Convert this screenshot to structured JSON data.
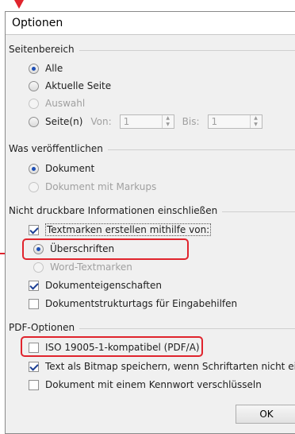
{
  "dialog": {
    "title": "Optionen"
  },
  "page_range": {
    "heading": "Seitenbereich",
    "all": "Alle",
    "current": "Aktuelle Seite",
    "selection": "Auswahl",
    "pages": "Seite(n)",
    "from_label": "Von:",
    "from_value": "1",
    "to_label": "Bis:",
    "to_value": "1"
  },
  "publish": {
    "heading": "Was veröffentlichen",
    "document": "Dokument",
    "document_markups": "Dokument mit Markups"
  },
  "nonprint": {
    "heading": "Nicht druckbare Informationen einschließen",
    "bookmarks": "Textmarken erstellen mithilfe von:",
    "headings": "Überschriften",
    "word_bookmarks": "Word-Textmarken",
    "doc_properties": "Dokumenteigenschaften",
    "structure_tags": "Dokumentstrukturtags für Eingabehilfen"
  },
  "pdf": {
    "heading": "PDF-Optionen",
    "iso": "ISO 19005-1-kompatibel (PDF/A)",
    "bitmap": "Text als Bitmap speichern, wenn Schriftarten nicht ein",
    "encrypt": "Dokument mit einem Kennwort verschlüsseln"
  },
  "buttons": {
    "ok": "OK"
  },
  "colors": {
    "annotation": "#e0242d",
    "radio_dot": "#1e4fb5"
  }
}
